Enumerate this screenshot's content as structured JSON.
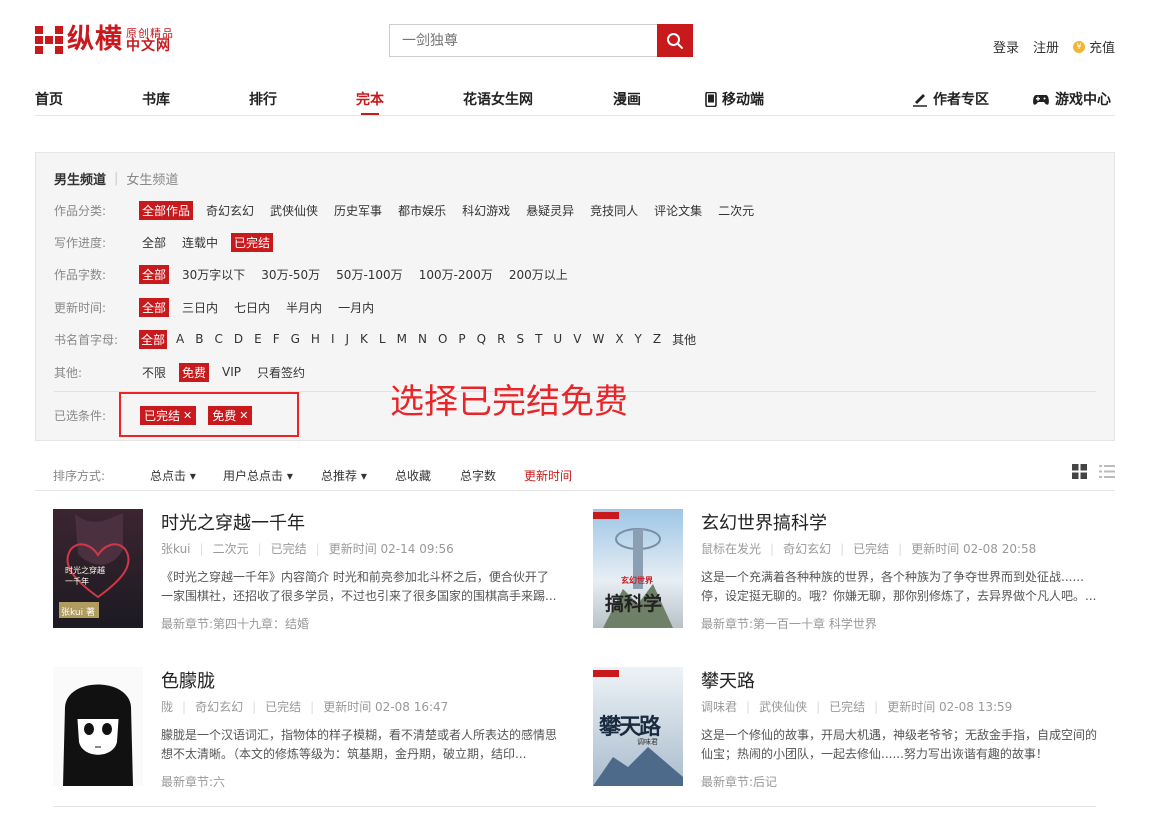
{
  "logo": {
    "main": "纵横",
    "sub_top": "原创精品",
    "sub_bottom": "中文网"
  },
  "search": {
    "placeholder": "一剑独尊"
  },
  "auth": {
    "login": "登录",
    "register": "注册",
    "recharge": "充值"
  },
  "nav": {
    "items": [
      "首页",
      "书库",
      "排行",
      "完本",
      "花语女生网",
      "漫画",
      "移动端"
    ],
    "author": "作者专区",
    "game": "游戏中心",
    "active": "完本"
  },
  "filter": {
    "channel_active": "男生频道",
    "channel_other": "女生频道",
    "rows": [
      {
        "label": "作品分类:",
        "options": [
          "全部作品",
          "奇幻玄幻",
          "武侠仙侠",
          "历史军事",
          "都市娱乐",
          "科幻游戏",
          "悬疑灵异",
          "竞技同人",
          "评论文集",
          "二次元"
        ],
        "selected": 0
      },
      {
        "label": "写作进度:",
        "options": [
          "全部",
          "连载中",
          "已完结"
        ],
        "selected": 2
      },
      {
        "label": "作品字数:",
        "options": [
          "全部",
          "30万字以下",
          "30万-50万",
          "50万-100万",
          "100万-200万",
          "200万以上"
        ],
        "selected": 0
      },
      {
        "label": "更新时间:",
        "options": [
          "全部",
          "三日内",
          "七日内",
          "半月内",
          "一月内"
        ],
        "selected": 0
      },
      {
        "label": "书名首字母:",
        "options": [
          "全部",
          "A",
          "B",
          "C",
          "D",
          "E",
          "F",
          "G",
          "H",
          "I",
          "J",
          "K",
          "L",
          "M",
          "N",
          "O",
          "P",
          "Q",
          "R",
          "S",
          "T",
          "U",
          "V",
          "W",
          "X",
          "Y",
          "Z",
          "其他"
        ],
        "selected": 0
      },
      {
        "label": "其他:",
        "options": [
          "不限",
          "免费",
          "VIP",
          "只看签约"
        ],
        "selected": 1
      }
    ],
    "chosen_label": "已选条件:",
    "chosen": [
      "已完结",
      "免费"
    ]
  },
  "annotation": "选择已完结免费",
  "sort": {
    "label": "排序方式:",
    "items": [
      "总点击",
      "用户总点击",
      "总推荐",
      "总收藏",
      "总字数",
      "更新时间"
    ],
    "active": "更新时间"
  },
  "books": [
    {
      "title": "时光之穿越一千年",
      "author": "张kui",
      "genre": "二次元",
      "status": "已完结",
      "updated_label": "更新时间",
      "updated": "02-14 09:56",
      "desc": "《时光之穿越一千年》内容简介 时光和前亮参加北斗杯之后，便合伙开了一家围棋社，还招收了很多学员，不过也引来了很多国家的围棋高手来踢...",
      "latest_label": "最新章节:",
      "latest": "第四十九章：结婚",
      "cover_text": "时光之穿越一千年",
      "cover_tag": "张kui 著"
    },
    {
      "title": "玄幻世界搞科学",
      "author": "鼠标在发光",
      "genre": "奇幻玄幻",
      "status": "已完结",
      "updated_label": "更新时间",
      "updated": "02-08 20:58",
      "desc": "这是一个充满着各种种族的世界，各个种族为了争夺世界而到处征战......停，设定挺无聊的。哦？你嫌无聊，那你别修炼了，去异界做个凡人吧。...",
      "latest_label": "最新章节:",
      "latest": "第一百一十章 科学世界",
      "cover_text": "搞科学",
      "cover_tag": "玄幻世界"
    },
    {
      "title": "色朦胧",
      "author": "陇",
      "genre": "奇幻玄幻",
      "status": "已完结",
      "updated_label": "更新时间",
      "updated": "02-08 16:47",
      "desc": "朦胧是一个汉语词汇，指物体的样子模糊，看不清楚或者人所表达的感情思想不太清晰。（本文的修炼等级为：筑基期，金丹期，破立期，结印...",
      "latest_label": "最新章节:",
      "latest": "六",
      "cover_text": "",
      "cover_tag": ""
    },
    {
      "title": "攀天路",
      "author": "调味君",
      "genre": "武侠仙侠",
      "status": "已完结",
      "updated_label": "更新时间",
      "updated": "02-08 13:59",
      "desc": "这是一个修仙的故事，开局大机遇，神级老爷爷；无敌金手指，自成空间的仙宝；热闹的小团队，一起去修仙......努力写出诙谐有趣的故事！",
      "latest_label": "最新章节:",
      "latest": "后记",
      "cover_text": "攀天路",
      "cover_tag": "调味君"
    }
  ],
  "colors": {
    "brand": "#c8191d",
    "annotation": "#e8262a"
  }
}
